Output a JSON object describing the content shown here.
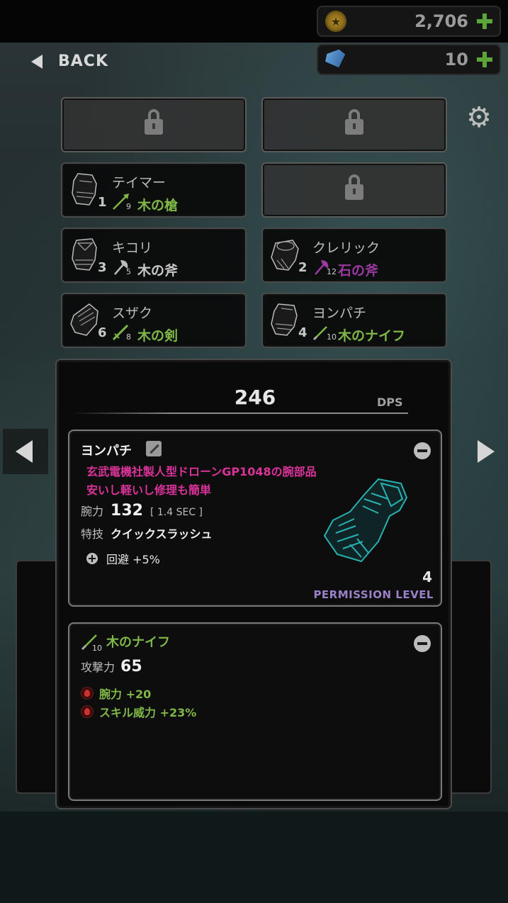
{
  "currency": {
    "coins": "2,706",
    "gems": "10",
    "coin_icon": "coin-icon",
    "gem_icon": "gem-icon",
    "add_icon": "plus-icon"
  },
  "nav": {
    "back_label": "BACK"
  },
  "slots": [
    {
      "state": "locked"
    },
    {
      "state": "locked"
    },
    {
      "state": "filled",
      "name": "テイマー",
      "level": "1",
      "weapon_level": "9",
      "weapon_name": "木の槍",
      "weapon_color": "#7fb848"
    },
    {
      "state": "locked"
    },
    {
      "state": "filled",
      "name": "キコリ",
      "level": "3",
      "weapon_level": "5",
      "weapon_name": "木の斧",
      "weapon_color": "#c8c8c8"
    },
    {
      "state": "filled",
      "name": "クレリック",
      "level": "2",
      "weapon_level": "12",
      "weapon_name": "石の斧",
      "weapon_color": "#9a3aa0"
    },
    {
      "state": "filled",
      "name": "スザク",
      "level": "6",
      "weapon_level": "8",
      "weapon_name": "木の剣",
      "weapon_color": "#7fb848"
    },
    {
      "state": "filled",
      "name": "ヨンパチ",
      "level": "4",
      "weapon_level": "10",
      "weapon_name": "木のナイフ",
      "weapon_color": "#7fb848"
    }
  ],
  "detail": {
    "dps_value": "246",
    "dps_label": "DPS",
    "unit": {
      "name": "ヨンパチ",
      "description_line1": "玄武電機社製人型ドローンGP1048の腕部品",
      "description_line2": "安いし軽いし修理も簡単",
      "power_label": "腕力",
      "power_value": "132",
      "interval": "[ 1.4 SEC ]",
      "skill_label": "特技",
      "skill_value": "クイックスラッシュ",
      "bonus": "回避 +5%",
      "permission_level_value": "4",
      "permission_level_label": "PERMISSION LEVEL"
    },
    "weapon": {
      "level": "10",
      "name": "木のナイフ",
      "attack_label": "攻撃力",
      "attack_value": "65",
      "bonus1": "腕力 +20",
      "bonus2": "スキル威力 +23%"
    }
  },
  "colors": {
    "accent_green": "#7fb848",
    "rarity_purple": "#9a3aa0",
    "description_pink": "#d9339a",
    "permission_purple": "#9a80c8"
  }
}
